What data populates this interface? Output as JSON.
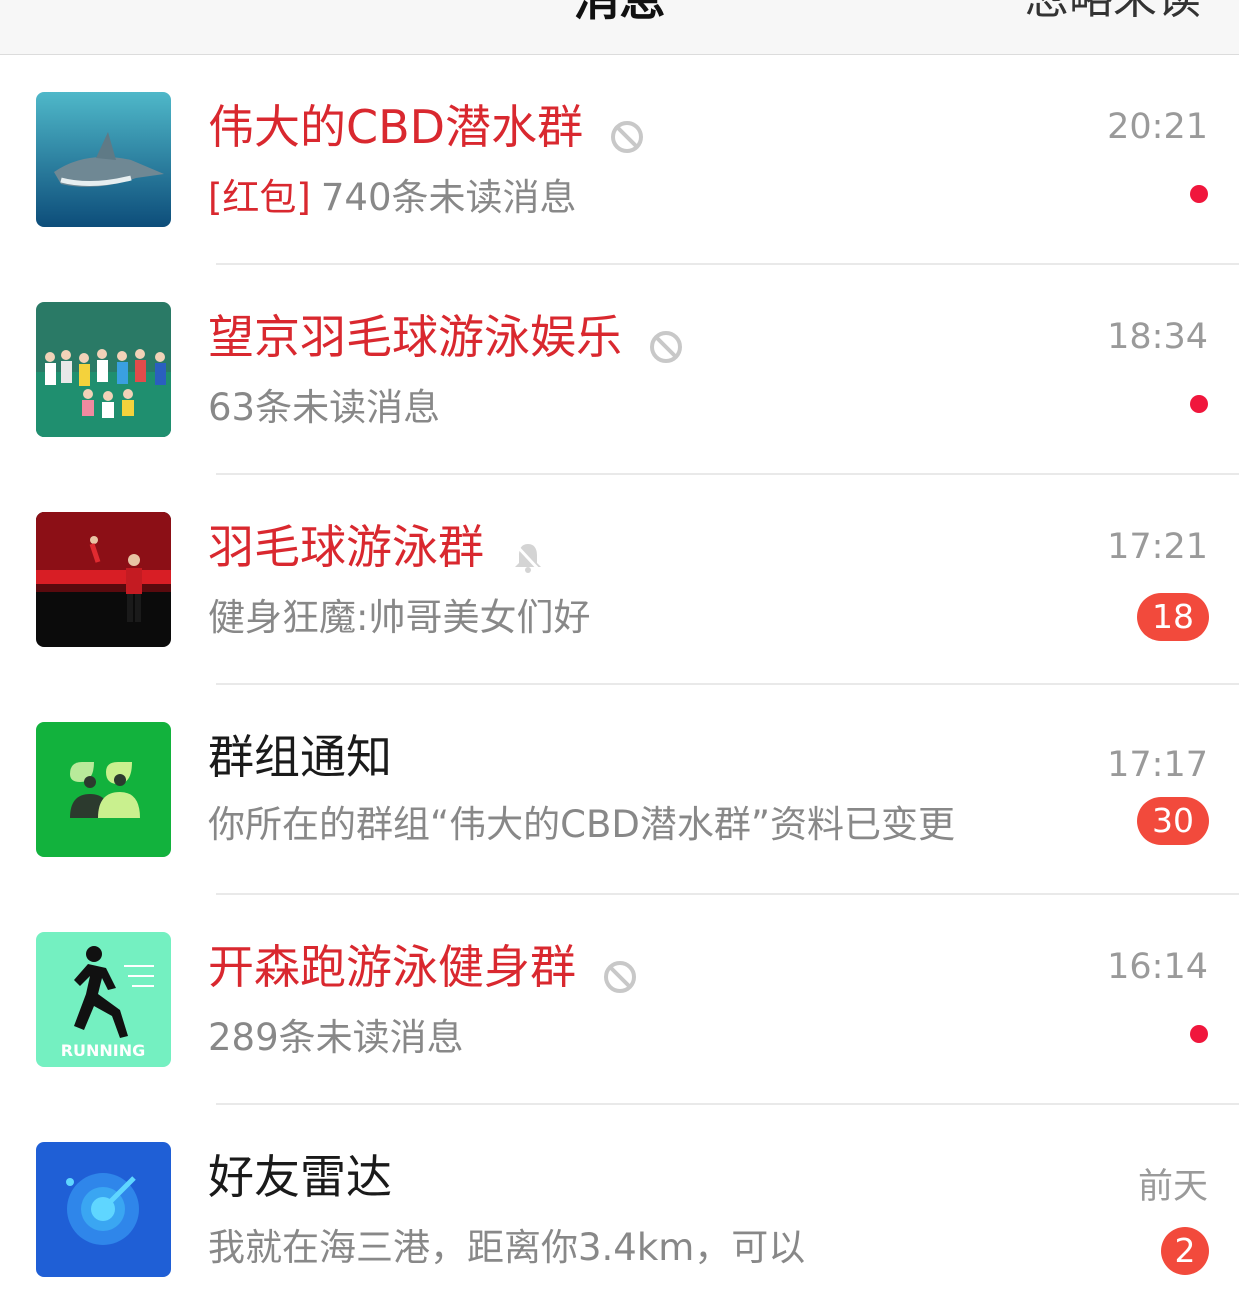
{
  "header": {
    "title": "消息",
    "right_action": "忽略未读"
  },
  "conversations": [
    {
      "name": "伟大的CBD潜水群",
      "preview_tag": "[红包]",
      "preview": "740条未读消息",
      "time": "20:21",
      "muted_icon": "block-icon",
      "unread": "dot",
      "name_color": "#d9282f"
    },
    {
      "name": "望京羽毛球游泳娱乐",
      "preview_tag": "",
      "preview": "63条未读消息",
      "time": "18:34",
      "muted_icon": "block-icon",
      "unread": "dot",
      "name_color": "#d9282f"
    },
    {
      "name": "羽毛球游泳群",
      "preview_tag": "",
      "preview": "健身狂魔:帅哥美女们好",
      "time": "17:21",
      "muted_icon": "bell-off-icon",
      "badge": "18",
      "name_color": "#d9282f"
    },
    {
      "name": "群组通知",
      "preview_tag": "",
      "preview": "你所在的群组“伟大的CBD潜水群”资料已变更",
      "time": "17:17",
      "badge": "30",
      "name_color": "#1a1a1a"
    },
    {
      "name": "开森跑游泳健身群",
      "preview_tag": "",
      "preview": "289条未读消息",
      "time": "16:14",
      "muted_icon": "block-icon",
      "unread": "dot",
      "name_color": "#d9282f"
    },
    {
      "name": "好友雷达",
      "preview_tag": "",
      "preview": "我就在海三港，距离你3.4km，可以",
      "time": "前天",
      "badge": "2",
      "name_color": "#1a1a1a"
    }
  ],
  "avatars": {
    "running_label": "RUNNING"
  },
  "colors": {
    "accent_red": "#d9282f",
    "dot_red": "#f0163c",
    "badge_red": "#f24a3c"
  }
}
